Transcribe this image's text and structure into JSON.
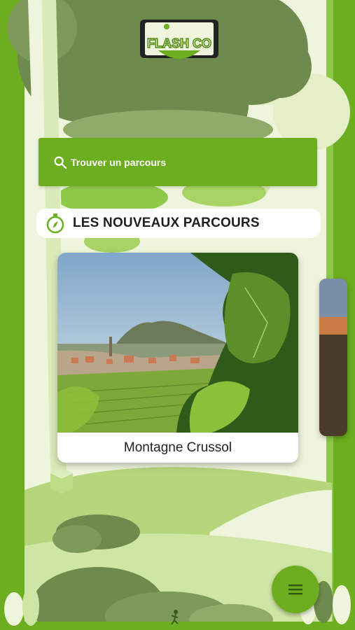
{
  "app": {
    "logo_text": "FLASH CO"
  },
  "search": {
    "label": "Trouver un parcours",
    "icon": "search-icon"
  },
  "section": {
    "title": "LES NOUVEAUX PARCOURS",
    "icon": "compass-icon"
  },
  "routes": [
    {
      "name": "Montagne Crussol"
    }
  ],
  "menu_button": {
    "icon": "hamburger-menu-icon"
  },
  "colors": {
    "brand_green": "#6cae1f",
    "dark_green": "#4f8c12",
    "accent": "#2d5a0a"
  }
}
